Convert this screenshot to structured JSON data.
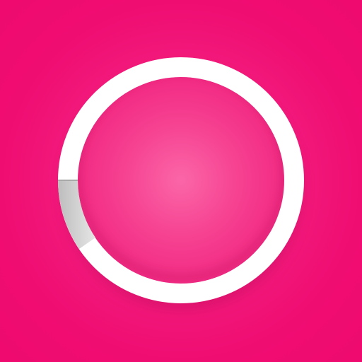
{
  "app": {
    "name": ""
  },
  "icon": {
    "name": "ring-icon",
    "colors": {
      "background": "#f20c74",
      "background_center": "#f95aa3",
      "ring": "#ffffff",
      "ring_shadow_accent": "#b9b9b9"
    }
  }
}
